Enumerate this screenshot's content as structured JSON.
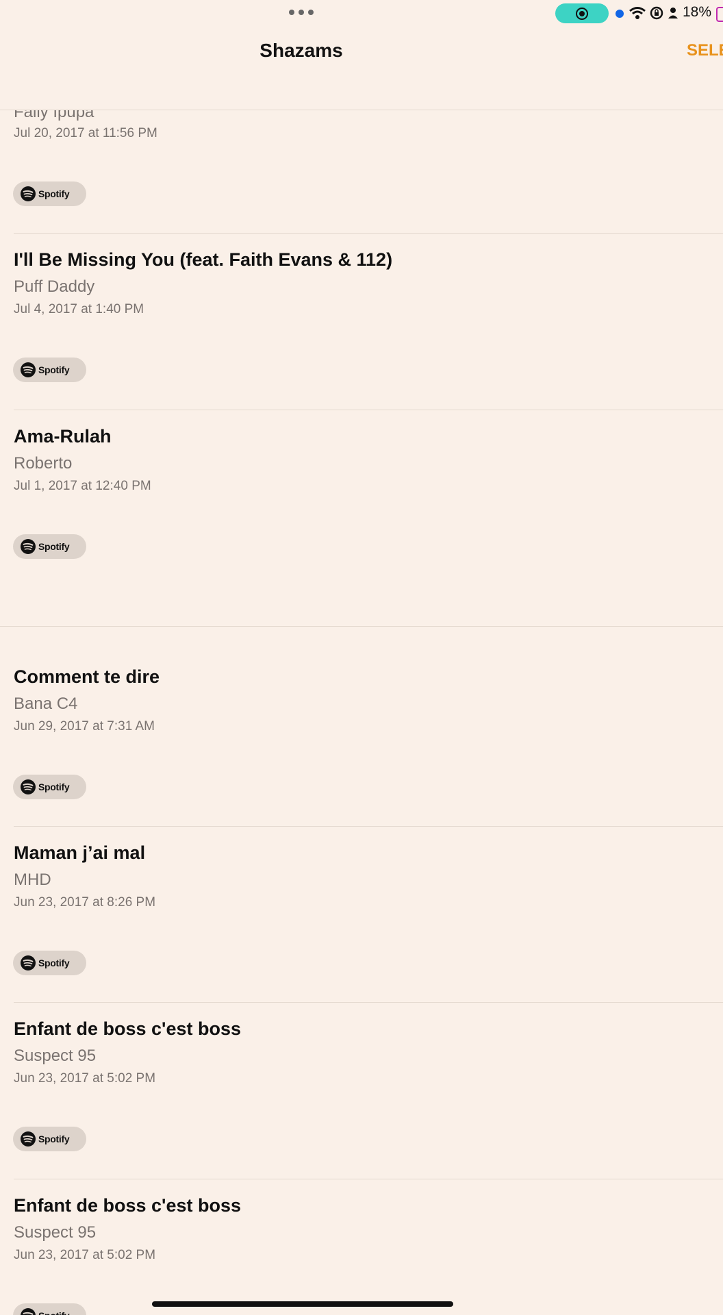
{
  "nav": {
    "title": "Shazams",
    "select_label": "SELE"
  },
  "status": {
    "battery": "18%"
  },
  "spotify_label": "Spotify",
  "items": [
    {
      "title": "",
      "artist": "Fally Ipupa",
      "date": "Jul 20, 2017 at 11:56 PM"
    },
    {
      "title": "I'll Be Missing You (feat. Faith Evans & 112)",
      "artist": "Puff Daddy",
      "date": "Jul 4, 2017 at 1:40 PM"
    },
    {
      "title": "Ama-Rulah",
      "artist": "Roberto",
      "date": "Jul 1, 2017 at 12:40 PM"
    },
    {
      "title": "Comment te dire",
      "artist": "Bana C4",
      "date": "Jun 29, 2017 at 7:31 AM"
    },
    {
      "title": "Maman j’ai mal",
      "artist": "MHD",
      "date": "Jun 23, 2017 at 8:26 PM"
    },
    {
      "title": "Enfant de boss c'est boss",
      "artist": "Suspect 95",
      "date": "Jun 23, 2017 at 5:02 PM"
    },
    {
      "title": "Enfant de boss c'est boss",
      "artist": "Suspect 95",
      "date": "Jun 23, 2017 at 5:02 PM"
    }
  ]
}
